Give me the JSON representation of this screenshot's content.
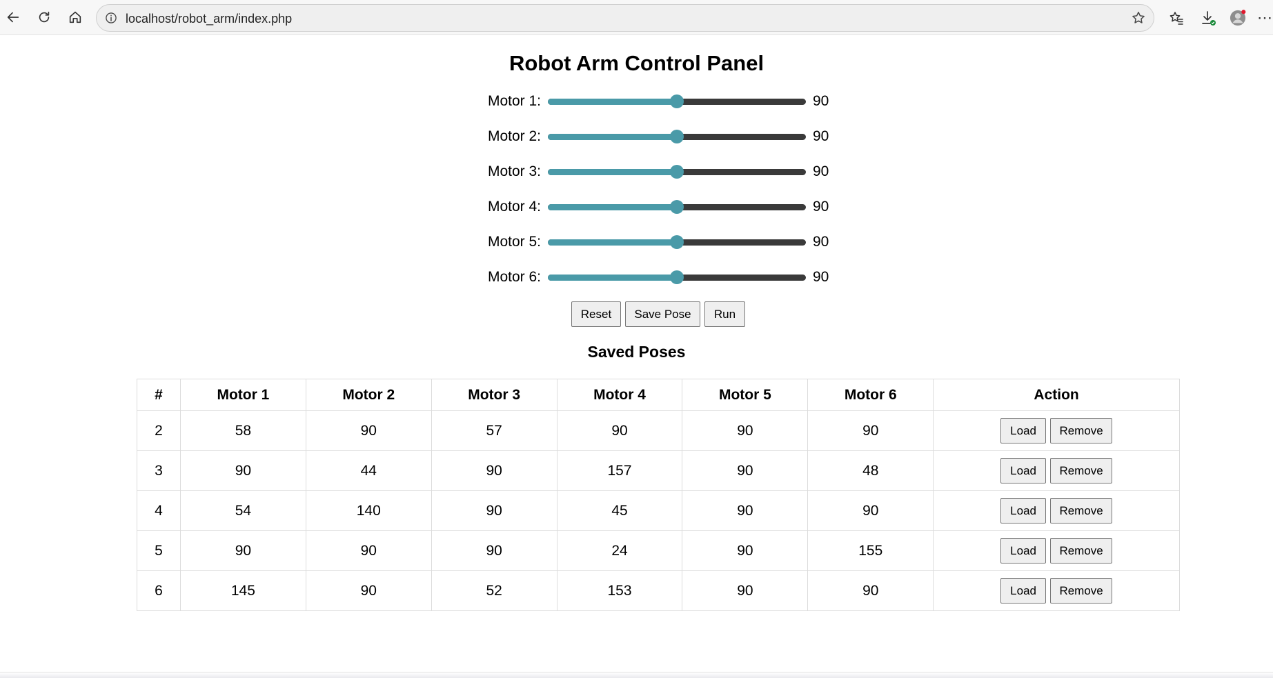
{
  "browser": {
    "url": "localhost/robot_arm/index.php",
    "icons": [
      "back-arrow-icon",
      "refresh-icon",
      "home-icon",
      "info-icon",
      "star-icon",
      "favorites-icon",
      "downloads-icon",
      "profile-icon",
      "more-dots-icon"
    ]
  },
  "page": {
    "title": "Robot Arm Control Panel",
    "motors": [
      {
        "label": "Motor 1:",
        "value": "90",
        "fraction": 0.5
      },
      {
        "label": "Motor 2:",
        "value": "90",
        "fraction": 0.5
      },
      {
        "label": "Motor 3:",
        "value": "90",
        "fraction": 0.5
      },
      {
        "label": "Motor 4:",
        "value": "90",
        "fraction": 0.5
      },
      {
        "label": "Motor 5:",
        "value": "90",
        "fraction": 0.5
      },
      {
        "label": "Motor 6:",
        "value": "90",
        "fraction": 0.5
      }
    ],
    "buttons": {
      "reset": "Reset",
      "save_pose": "Save Pose",
      "run": "Run"
    },
    "saved_title": "Saved Poses",
    "slider_color": "#4a9aa8"
  },
  "table": {
    "headers": [
      "#",
      "Motor 1",
      "Motor 2",
      "Motor 3",
      "Motor 4",
      "Motor 5",
      "Motor 6",
      "Action"
    ],
    "rows": [
      [
        "2",
        "58",
        "90",
        "57",
        "90",
        "90",
        "90"
      ],
      [
        "3",
        "90",
        "44",
        "90",
        "157",
        "90",
        "48"
      ],
      [
        "4",
        "54",
        "140",
        "90",
        "45",
        "90",
        "90"
      ],
      [
        "5",
        "90",
        "90",
        "90",
        "24",
        "90",
        "155"
      ],
      [
        "6",
        "145",
        "90",
        "52",
        "153",
        "90",
        "90"
      ]
    ],
    "load_label": "Load",
    "remove_label": "Remove"
  }
}
